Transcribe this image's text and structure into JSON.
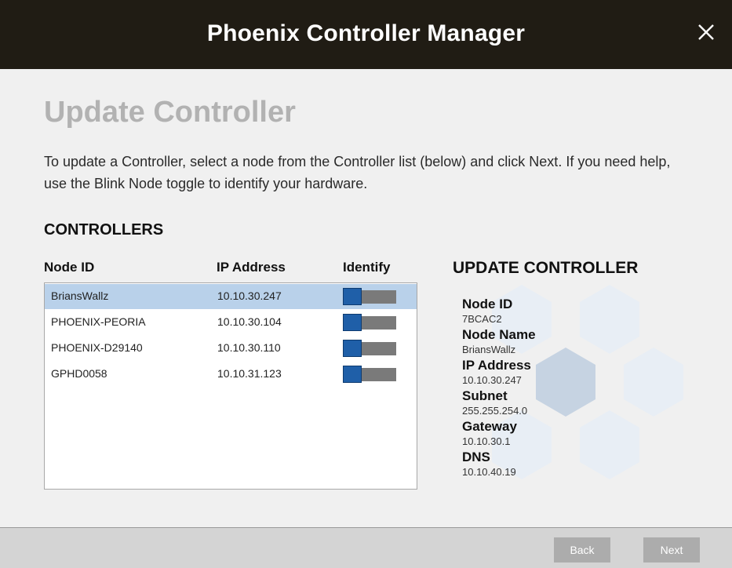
{
  "window": {
    "title": "Phoenix Controller Manager",
    "close_icon": "close-icon"
  },
  "page": {
    "heading": "Update Controller",
    "description": "To update a Controller, select a node from the Controller list (below) and click Next.  If you need help, use the Blink Node toggle to identify your hardware."
  },
  "controllers": {
    "section_title": "CONTROLLERS",
    "columns": {
      "node_id": "Node ID",
      "ip_address": "IP Address",
      "identify": "Identify"
    },
    "rows": [
      {
        "node_id": "BriansWallz",
        "ip_address": "10.10.30.247",
        "selected": true
      },
      {
        "node_id": "PHOENIX-PEORIA",
        "ip_address": "10.10.30.104",
        "selected": false
      },
      {
        "node_id": "PHOENIX-D29140",
        "ip_address": "10.10.30.110",
        "selected": false
      },
      {
        "node_id": "GPHD0058",
        "ip_address": "10.10.31.123",
        "selected": false
      }
    ]
  },
  "update_panel": {
    "title": "UPDATE CONTROLLER",
    "fields": [
      {
        "label": "Node ID",
        "value": "7BCAC2"
      },
      {
        "label": "Node Name",
        "value": "BriansWallz"
      },
      {
        "label": "IP Address",
        "value": "10.10.30.247"
      },
      {
        "label": "Subnet",
        "value": "255.255.254.0"
      },
      {
        "label": "Gateway",
        "value": "10.10.30.1"
      },
      {
        "label": "DNS",
        "value": "10.10.40.19"
      }
    ]
  },
  "footer": {
    "back_label": "Back",
    "next_label": "Next"
  },
  "colors": {
    "titlebar": "#201c14",
    "selected_row": "#b9d1ea",
    "toggle_knob": "#1f5fa8",
    "toggle_track": "#7a7a7a",
    "hex_light": "#e8eef5",
    "hex_dark": "#c6d3e2"
  }
}
